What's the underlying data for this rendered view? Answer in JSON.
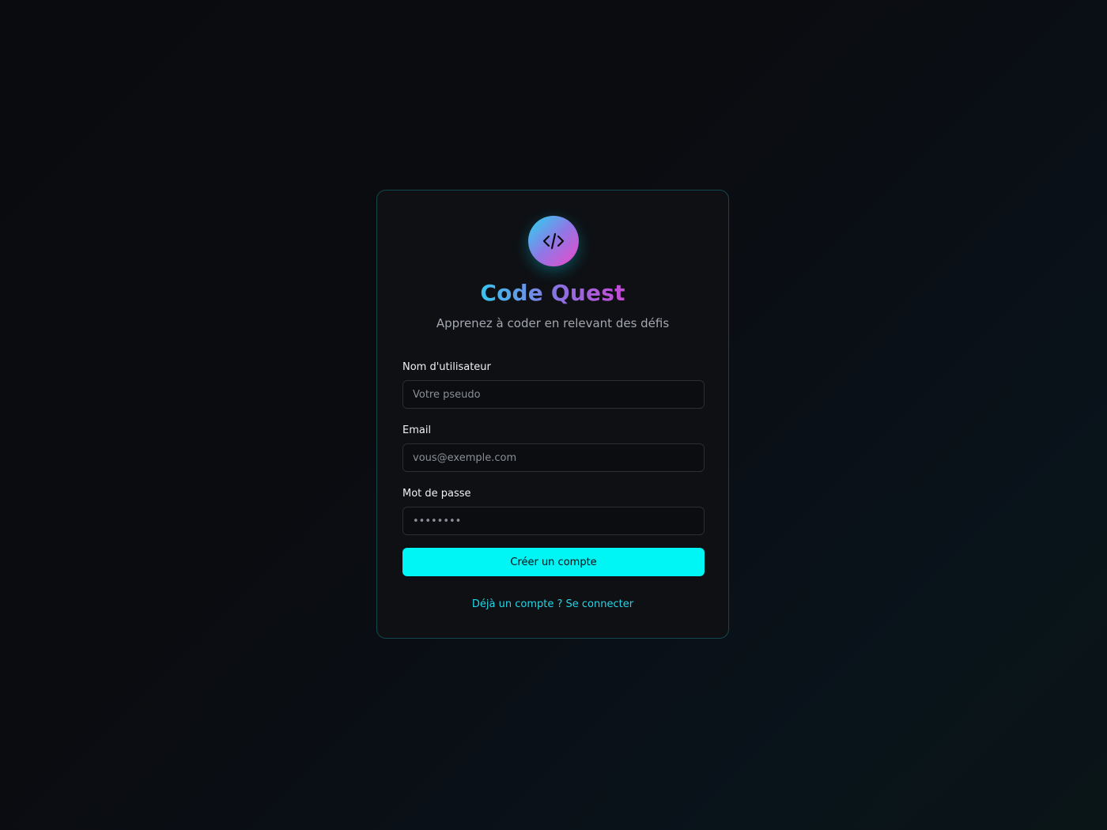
{
  "app": {
    "title": "Code Quest",
    "subtitle": "Apprenez à coder en relevant des défis",
    "logo_icon": "code-icon"
  },
  "form": {
    "username": {
      "label": "Nom d'utilisateur",
      "placeholder": "Votre pseudo",
      "value": ""
    },
    "email": {
      "label": "Email",
      "placeholder": "vous@exemple.com",
      "value": ""
    },
    "password": {
      "label": "Mot de passe",
      "placeholder": "••••••••",
      "value": ""
    },
    "submit_label": "Créer un compte",
    "login_link": "Déjà un compte ? Se connecter"
  },
  "colors": {
    "accent": "#00f5f5",
    "link": "#22d6e6",
    "card_border": "#12484c",
    "background": "#0b0c10"
  }
}
